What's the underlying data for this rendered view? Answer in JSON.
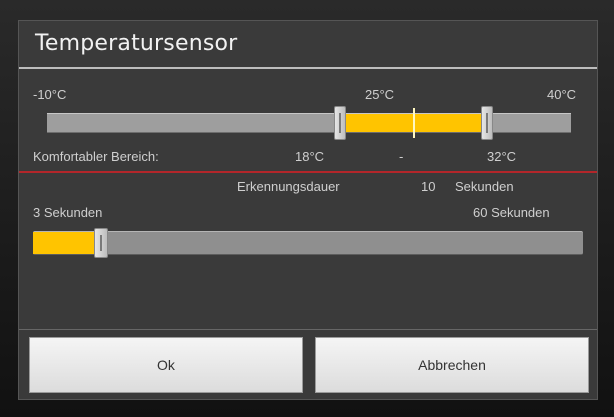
{
  "dialog": {
    "title": "Temperatursensor"
  },
  "temperature_range": {
    "min_label": "-10°C",
    "mid_label": "25°C",
    "max_label": "40°C",
    "min_value": -10,
    "max_value": 40,
    "current_value": 25,
    "comfort_low": 18,
    "comfort_high": 32,
    "comfort_label": "Komfortabler Bereich:",
    "comfort_low_label": "18°C",
    "comfort_separator": "-",
    "comfort_high_label": "32°C",
    "accent_color": "#ffc400"
  },
  "detection": {
    "label": "Erkennungsdauer",
    "value_label": "10",
    "unit_label": "Sekunden",
    "min_label": "3 Sekunden",
    "max_label": "60 Sekunden",
    "min_value": 3,
    "max_value": 60,
    "current_value": 10
  },
  "buttons": {
    "ok_label": "Ok",
    "cancel_label": "Abbrechen"
  }
}
